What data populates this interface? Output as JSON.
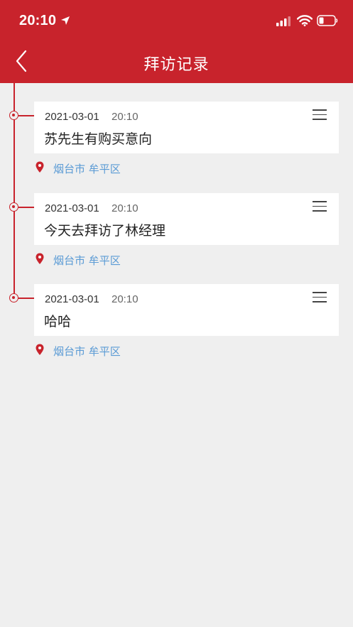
{
  "status_bar": {
    "time": "20:10"
  },
  "nav": {
    "title": "拜访记录"
  },
  "colors": {
    "brand_red": "#c8232c",
    "location_blue": "#5b9bd5",
    "background": "#efefef"
  },
  "visits": [
    {
      "date": "2021-03-01",
      "time": "20:10",
      "note": "苏先生有购买意向",
      "location": "烟台市 牟平区"
    },
    {
      "date": "2021-03-01",
      "time": "20:10",
      "note": "今天去拜访了林经理",
      "location": "烟台市 牟平区"
    },
    {
      "date": "2021-03-01",
      "time": "20:10",
      "note": "哈哈",
      "location": "烟台市 牟平区"
    }
  ]
}
